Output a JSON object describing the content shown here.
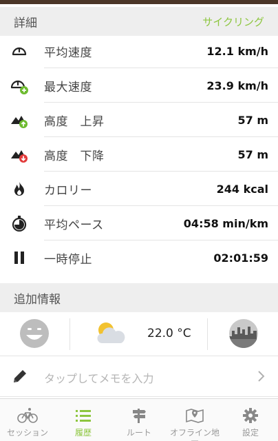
{
  "details_header": {
    "title": "詳細",
    "activity": "サイクリング"
  },
  "stats": [
    {
      "icon": "speedometer-icon",
      "label": "平均速度",
      "value": "12.1 km/h"
    },
    {
      "icon": "max-speedometer-icon",
      "label": "最大速度",
      "value": "23.9 km/h"
    },
    {
      "icon": "elevation-up-icon",
      "label": "高度　上昇",
      "value": "57 m"
    },
    {
      "icon": "elevation-down-icon",
      "label": "高度　下降",
      "value": "57 m"
    },
    {
      "icon": "flame-icon",
      "label": "カロリー",
      "value": "244 kcal"
    },
    {
      "icon": "stopwatch-icon",
      "label": "平均ペース",
      "value": "04:58 min/km"
    },
    {
      "icon": "pause-icon",
      "label": "一時停止",
      "value": "02:01:59"
    }
  ],
  "extra_header": {
    "title": "追加情報"
  },
  "extra": {
    "temperature": "22.0 °C"
  },
  "memo": {
    "placeholder": "タップしてメモを入力"
  },
  "tabs": [
    {
      "icon": "bicycle-icon",
      "label": "セッション",
      "active": false
    },
    {
      "icon": "list-icon",
      "label": "履歴",
      "active": true
    },
    {
      "icon": "signpost-icon",
      "label": "ルート",
      "active": false
    },
    {
      "icon": "offline-map-icon",
      "label": "オフライン地図",
      "active": false
    },
    {
      "icon": "gear-icon",
      "label": "設定",
      "active": false
    }
  ],
  "colors": {
    "accent": "#8dc63f",
    "green_badge": "#6dbb2f",
    "red_badge": "#e23a3a",
    "topbar": "#4b3628"
  }
}
